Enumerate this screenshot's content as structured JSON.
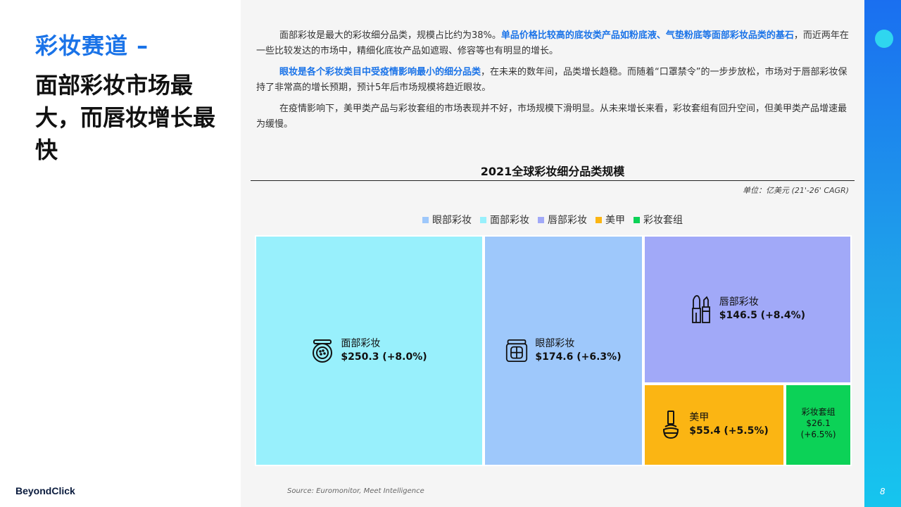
{
  "left": {
    "kicker": "彩妆赛道 –",
    "headline": "面部彩妆市场最大，而唇妆增长最快",
    "brand": "BeyondClick"
  },
  "paragraphs": [
    {
      "segments": [
        {
          "text": "面部彩妆是最大的彩妆细分品类，规模占比约为38%。",
          "hl": false
        },
        {
          "text": "单品价格比较高的底妆类产品如粉底液、气垫粉底等面部彩妆品类的基石",
          "hl": true
        },
        {
          "text": "，而近两年在一些比较发达的市场中，精细化底妆产品如遮瑕、修容等也有明显的增长。",
          "hl": false
        }
      ]
    },
    {
      "segments": [
        {
          "text": "眼妆是各个彩妆类目中受疫情影响最小的细分品类",
          "hl": true
        },
        {
          "text": "，在未来的数年间，品类增长趋稳。而随着“口罩禁令”的一步步放松，市场对于唇部彩妆保持了非常高的增长预期，预计5年后市场规模将趋近眼妆。",
          "hl": false
        }
      ]
    },
    {
      "segments": [
        {
          "text": "在疫情影响下，美甲类产品与彩妆套组的市场表现并不好，市场规模下滑明显。从未来增长来看，彩妆套组有回升空间，但美甲类产品增速最为缓慢。",
          "hl": false
        }
      ]
    }
  ],
  "chart_data": {
    "type": "treemap",
    "title": "2021全球彩妆细分品类规模",
    "unit_note": "单位：亿美元 (21'-26' CAGR)",
    "legend": [
      {
        "name": "眼部彩妆",
        "color": "#9ec8fb"
      },
      {
        "name": "面部彩妆",
        "color": "#98f0fc"
      },
      {
        "name": "唇部彩妆",
        "color": "#a1a9f8"
      },
      {
        "name": "美甲",
        "color": "#fbb513"
      },
      {
        "name": "彩妆套组",
        "color": "#0cd257"
      }
    ],
    "series": [
      {
        "name": "面部彩妆",
        "value": 250.3,
        "cagr_label": "(+8.0%)",
        "value_label": "$250.3 (+8.0%)",
        "color": "#98f0fc",
        "icon": "cushion-compact-icon"
      },
      {
        "name": "眼部彩妆",
        "value": 174.6,
        "cagr_label": "(+6.3%)",
        "value_label": "$174.6 (+6.3%)",
        "color": "#9ec8fb",
        "icon": "eyeshadow-palette-icon"
      },
      {
        "name": "唇部彩妆",
        "value": 146.5,
        "cagr_label": "(+8.4%)",
        "value_label": "$146.5 (+8.4%)",
        "color": "#a1a9f8",
        "icon": "lipstick-icon"
      },
      {
        "name": "美甲",
        "value": 55.4,
        "cagr_label": "(+5.5%)",
        "value_label": "$55.4 (+5.5%)",
        "color": "#fbb513",
        "icon": "nail-polish-icon"
      },
      {
        "name": "彩妆套组",
        "value": 26.1,
        "cagr_label": "(+6.5%)",
        "value_label": "$26.1",
        "color": "#0cd257",
        "icon": ""
      }
    ]
  },
  "source": "Source: Euromonitor, Meet Intelligence",
  "page_number": "8"
}
